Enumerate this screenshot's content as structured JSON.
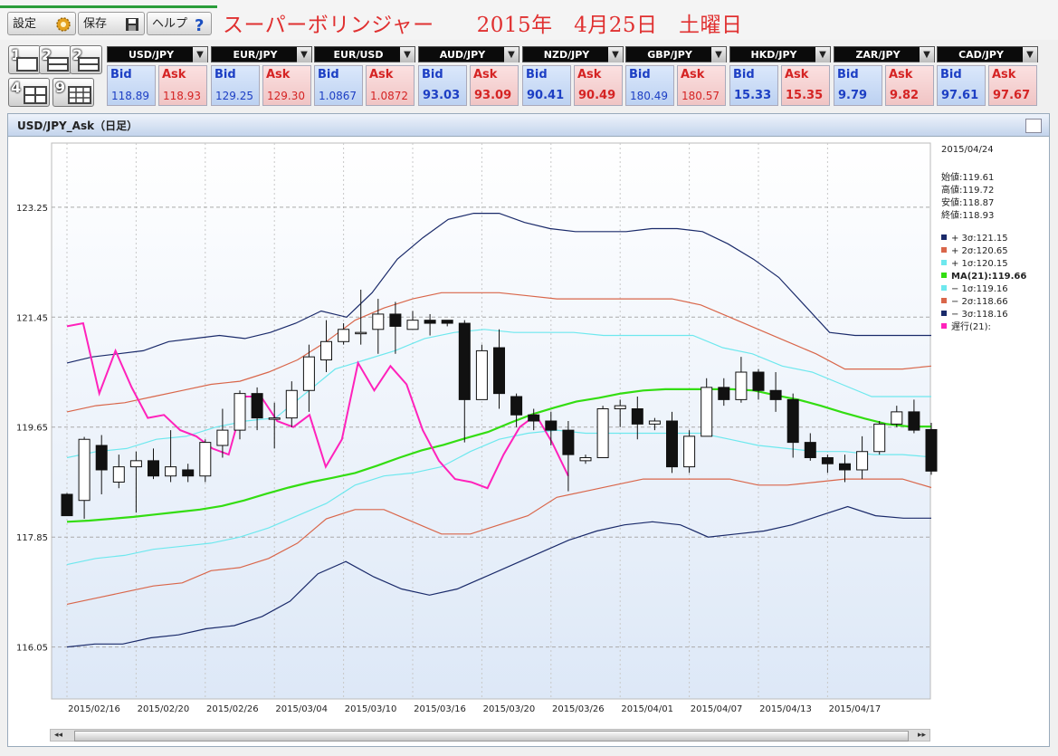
{
  "toolbar": {
    "settings_label": "設定",
    "save_label": "保存",
    "help_label": "ヘルプ"
  },
  "title_text": "スーパーボリンジャー　　2015年　4月25日　土曜日",
  "layout_buttons": [
    {
      "label": "1",
      "name": "layout-1"
    },
    {
      "label": "2",
      "name": "layout-2"
    },
    {
      "label": "2",
      "name": "layout-2b"
    },
    {
      "label": "4",
      "name": "layout-4"
    },
    {
      "label": "9",
      "name": "layout-9"
    }
  ],
  "quotes": [
    {
      "symbol": "USD/JPY",
      "bid_label": "Bid",
      "ask_label": "Ask",
      "bid": "118.89",
      "ask": "118.93"
    },
    {
      "symbol": "EUR/JPY",
      "bid_label": "Bid",
      "ask_label": "Ask",
      "bid": "129.25",
      "ask": "129.30"
    },
    {
      "symbol": "EUR/USD",
      "bid_label": "Bid",
      "ask_label": "Ask",
      "bid": "1.0867",
      "ask": "1.0872"
    },
    {
      "symbol": "AUD/JPY",
      "bid_label": "Bid",
      "ask_label": "Ask",
      "bid": "93.03",
      "ask": "93.09"
    },
    {
      "symbol": "NZD/JPY",
      "bid_label": "Bid",
      "ask_label": "Ask",
      "bid": "90.41",
      "ask": "90.49"
    },
    {
      "symbol": "GBP/JPY",
      "bid_label": "Bid",
      "ask_label": "Ask",
      "bid": "180.49",
      "ask": "180.57"
    },
    {
      "symbol": "HKD/JPY",
      "bid_label": "Bid",
      "ask_label": "Ask",
      "bid": "15.33",
      "ask": "15.35"
    },
    {
      "symbol": "ZAR/JPY",
      "bid_label": "Bid",
      "ask_label": "Ask",
      "bid": "9.79",
      "ask": "9.82"
    },
    {
      "symbol": "CAD/JPY",
      "bid_label": "Bid",
      "ask_label": "Ask",
      "bid": "97.61",
      "ask": "97.67"
    }
  ],
  "chart_panel": {
    "title": "USD/JPY_Ask（日足）"
  },
  "ohlc_box": {
    "date": "2015/04/24",
    "open": "始値:119.61",
    "high": "高値:119.72",
    "low": "安値:118.87",
    "close": "終値:118.93"
  },
  "legend": [
    {
      "label": "+ 3σ:121.15",
      "color": "#1a2a6a"
    },
    {
      "label": "+ 2σ:120.65",
      "color": "#d9664a"
    },
    {
      "label": "+ 1σ:120.15",
      "color": "#6ee8ee"
    },
    {
      "label": "MA(21):119.66",
      "color": "#33dd11",
      "bold": true
    },
    {
      "label": "− 1σ:119.16",
      "color": "#6ee8ee"
    },
    {
      "label": "− 2σ:118.66",
      "color": "#d9664a"
    },
    {
      "label": "− 3σ:118.16",
      "color": "#1a2a6a"
    },
    {
      "label": "遅行(21):",
      "color": "#ff22bb"
    }
  ],
  "scrollbar": {
    "left": "◂◂",
    "right": "▸▸"
  },
  "chart_data": {
    "type": "candlestick",
    "title": "USD/JPY_Ask（日足）",
    "ylim": [
      115.2,
      124.3
    ],
    "y_ticks": [
      "123.25",
      "121.45",
      "119.65",
      "117.85",
      "116.05"
    ],
    "x_ticks": [
      "2015/02/16",
      "2015/02/20",
      "2015/02/26",
      "2015/03/04",
      "2015/03/10",
      "2015/03/16",
      "2015/03/20",
      "2015/03/26",
      "2015/04/01",
      "2015/04/07",
      "2015/04/13",
      "2015/04/17"
    ],
    "tick_positions": [
      0,
      4,
      8,
      12,
      16,
      20,
      24,
      28,
      32,
      36,
      40,
      44
    ],
    "ohlc": [
      [
        118.55,
        118.2,
        118.57,
        118.21
      ],
      [
        118.45,
        119.45,
        119.49,
        118.15
      ],
      [
        119.35,
        118.95,
        119.52,
        118.55
      ],
      [
        118.75,
        119.0,
        119.2,
        118.65
      ],
      [
        119.0,
        119.1,
        119.25,
        118.25
      ],
      [
        119.1,
        118.85,
        119.3,
        118.8
      ],
      [
        118.85,
        119.0,
        119.6,
        118.75
      ],
      [
        118.95,
        118.85,
        119.05,
        118.75
      ],
      [
        118.85,
        119.4,
        119.45,
        118.75
      ],
      [
        119.35,
        119.6,
        119.95,
        119.15
      ],
      [
        119.6,
        120.2,
        120.25,
        119.45
      ],
      [
        120.2,
        119.8,
        120.3,
        119.6
      ],
      [
        119.8,
        119.8,
        120.05,
        119.3
      ],
      [
        119.8,
        120.25,
        120.4,
        119.65
      ],
      [
        120.25,
        120.8,
        121.0,
        119.9
      ],
      [
        120.75,
        121.05,
        121.4,
        120.55
      ],
      [
        121.05,
        121.25,
        121.35,
        121.0
      ],
      [
        121.2,
        121.2,
        121.9,
        121.0
      ],
      [
        121.25,
        121.5,
        121.75,
        120.85
      ],
      [
        121.5,
        121.3,
        121.7,
        120.85
      ],
      [
        121.25,
        121.4,
        121.55,
        121.25
      ],
      [
        121.4,
        121.35,
        121.5,
        121.15
      ],
      [
        121.4,
        121.35,
        121.4,
        121.3
      ],
      [
        121.35,
        120.1,
        121.4,
        119.4
      ],
      [
        120.1,
        120.9,
        121.0,
        120.1
      ],
      [
        120.95,
        120.2,
        121.25,
        119.95
      ],
      [
        120.15,
        119.85,
        120.2,
        119.65
      ],
      [
        119.85,
        119.75,
        119.95,
        119.6
      ],
      [
        119.75,
        119.6,
        119.9,
        119.35
      ],
      [
        119.6,
        119.2,
        119.75,
        118.6
      ],
      [
        119.1,
        119.15,
        119.2,
        119.05
      ],
      [
        119.15,
        119.95,
        120.0,
        119.15
      ],
      [
        119.95,
        120.0,
        120.1,
        119.65
      ],
      [
        119.95,
        119.7,
        120.15,
        119.45
      ],
      [
        119.7,
        119.75,
        119.8,
        119.6
      ],
      [
        119.75,
        119.0,
        119.9,
        118.9
      ],
      [
        119.0,
        119.5,
        119.6,
        118.9
      ],
      [
        119.5,
        120.3,
        120.45,
        119.5
      ],
      [
        120.3,
        120.1,
        120.45,
        120.0
      ],
      [
        120.1,
        120.55,
        120.8,
        120.05
      ],
      [
        120.55,
        120.25,
        120.6,
        120.1
      ],
      [
        120.25,
        120.1,
        120.55,
        119.9
      ],
      [
        120.1,
        119.4,
        120.2,
        119.15
      ],
      [
        119.4,
        119.15,
        119.55,
        119.1
      ],
      [
        119.15,
        119.05,
        119.2,
        118.9
      ],
      [
        119.05,
        118.95,
        119.2,
        118.75
      ],
      [
        118.95,
        119.25,
        119.5,
        118.8
      ],
      [
        119.25,
        119.7,
        119.75,
        119.2
      ],
      [
        119.7,
        119.9,
        120.0,
        119.65
      ],
      [
        119.9,
        119.6,
        120.1,
        119.55
      ],
      [
        119.61,
        118.93,
        119.72,
        118.87
      ]
    ],
    "ma21": [
      118.1,
      118.12,
      118.15,
      118.18,
      118.22,
      118.26,
      118.3,
      118.36,
      118.45,
      118.56,
      118.66,
      118.75,
      118.82,
      118.9,
      119.02,
      119.15,
      119.27,
      119.36,
      119.47,
      119.57,
      119.72,
      119.86,
      119.97,
      120.07,
      120.13,
      120.2,
      120.25,
      120.27,
      120.27,
      120.27,
      120.27,
      120.25,
      120.17,
      120.1,
      120.0,
      119.89,
      119.79,
      119.7,
      119.66,
      119.66
    ],
    "plus3": [
      120.7,
      120.8,
      120.85,
      120.9,
      121.05,
      121.1,
      121.15,
      121.1,
      121.2,
      121.35,
      121.55,
      121.45,
      121.85,
      122.4,
      122.75,
      123.05,
      123.15,
      123.15,
      123.0,
      122.9,
      122.85,
      122.85,
      122.85,
      122.9,
      122.9,
      122.85,
      122.65,
      122.4,
      122.1,
      121.65,
      121.2,
      121.15,
      121.15,
      121.15,
      121.15
    ],
    "plus2": [
      119.9,
      120.0,
      120.05,
      120.15,
      120.25,
      120.35,
      120.4,
      120.55,
      120.75,
      121.05,
      121.4,
      121.6,
      121.75,
      121.85,
      121.85,
      121.85,
      121.8,
      121.75,
      121.75,
      121.75,
      121.75,
      121.75,
      121.65,
      121.45,
      121.25,
      121.05,
      120.85,
      120.6,
      120.6,
      120.6,
      120.65
    ],
    "plus1": [
      119.15,
      119.25,
      119.3,
      119.45,
      119.5,
      119.65,
      119.75,
      119.8,
      120.2,
      120.6,
      120.75,
      120.9,
      121.1,
      121.2,
      121.25,
      121.2,
      121.2,
      121.2,
      121.15,
      121.15,
      121.15,
      121.15,
      120.95,
      120.85,
      120.65,
      120.55,
      120.35,
      120.15,
      120.15,
      120.15
    ],
    "minus1": [
      117.4,
      117.5,
      117.55,
      117.65,
      117.7,
      117.75,
      117.85,
      118.0,
      118.2,
      118.4,
      118.7,
      118.85,
      118.9,
      119.0,
      119.25,
      119.45,
      119.55,
      119.6,
      119.55,
      119.55,
      119.55,
      119.55,
      119.55,
      119.45,
      119.35,
      119.3,
      119.25,
      119.25,
      119.2,
      119.2,
      119.16
    ],
    "minus2": [
      116.75,
      116.85,
      116.95,
      117.05,
      117.1,
      117.3,
      117.35,
      117.5,
      117.75,
      118.15,
      118.3,
      118.3,
      118.1,
      117.9,
      117.9,
      118.05,
      118.2,
      118.5,
      118.6,
      118.7,
      118.8,
      118.8,
      118.8,
      118.8,
      118.7,
      118.7,
      118.75,
      118.8,
      118.8,
      118.8,
      118.66
    ],
    "minus3": [
      116.05,
      116.1,
      116.1,
      116.2,
      116.25,
      116.35,
      116.4,
      116.55,
      116.8,
      117.25,
      117.45,
      117.2,
      117.0,
      116.9,
      117.0,
      117.2,
      117.4,
      117.6,
      117.8,
      117.95,
      118.05,
      118.1,
      118.05,
      117.85,
      117.9,
      117.95,
      118.05,
      118.2,
      118.35,
      118.2,
      118.16,
      118.16
    ],
    "chikou": [
      121.3,
      121.35,
      120.2,
      120.9,
      120.3,
      119.8,
      119.85,
      119.6,
      119.5,
      119.3,
      119.2,
      120.15,
      120.15,
      119.75,
      119.65,
      119.85,
      119.0,
      119.45,
      120.7,
      120.25,
      120.65,
      120.35,
      119.6,
      119.1,
      118.8,
      118.75,
      118.65,
      119.2,
      119.65,
      119.85,
      119.4,
      118.85
    ]
  }
}
